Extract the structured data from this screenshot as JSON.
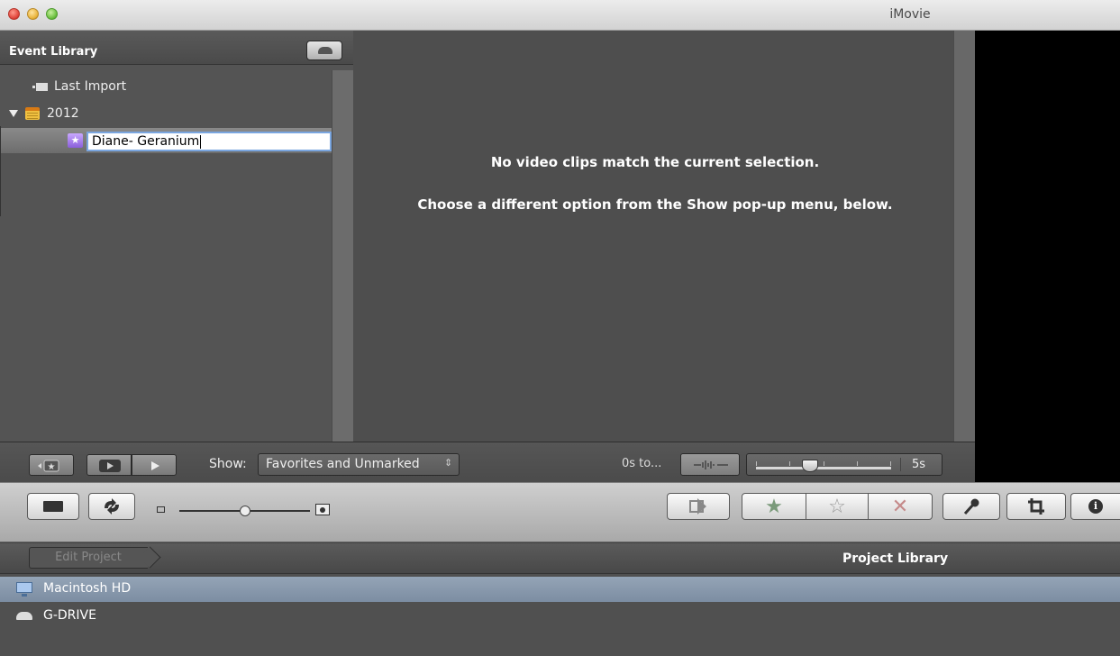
{
  "window": {
    "title": "iMovie"
  },
  "event_library": {
    "header": "Event Library",
    "items": [
      {
        "label": "Last Import"
      },
      {
        "label": "2012"
      },
      {
        "label": "Diane- Geranium",
        "editing": true
      }
    ]
  },
  "viewer": {
    "message_primary": "No video clips match the current selection.",
    "message_secondary": "Choose a different option from the Show pop-up menu, below."
  },
  "event_toolbar": {
    "show_label": "Show:",
    "show_value": "Favorites and Unmarked",
    "select_arrows": "⇕",
    "duration_label": "0s to...",
    "duration_max": "5s",
    "duration_level": 0.4
  },
  "main_toolbar": {
    "thumbnail_size_level": 0.5,
    "icons": [
      "camera-icon",
      "swap-icon",
      "add-to-project-icon",
      "favorite-star-icon",
      "unmark-star-icon",
      "reject-x-icon",
      "voiceover-mic-icon",
      "crop-icon",
      "info-icon"
    ]
  },
  "project_library": {
    "edit_button": "Edit Project",
    "title": "Project Library",
    "drives": [
      {
        "label": "Macintosh HD",
        "selected": true
      },
      {
        "label": "G-DRIVE",
        "selected": false
      }
    ]
  },
  "colors": {
    "selection_blue": "#7c8da2",
    "favorite": "#7a9a7a",
    "reject": "#c58a8a"
  }
}
